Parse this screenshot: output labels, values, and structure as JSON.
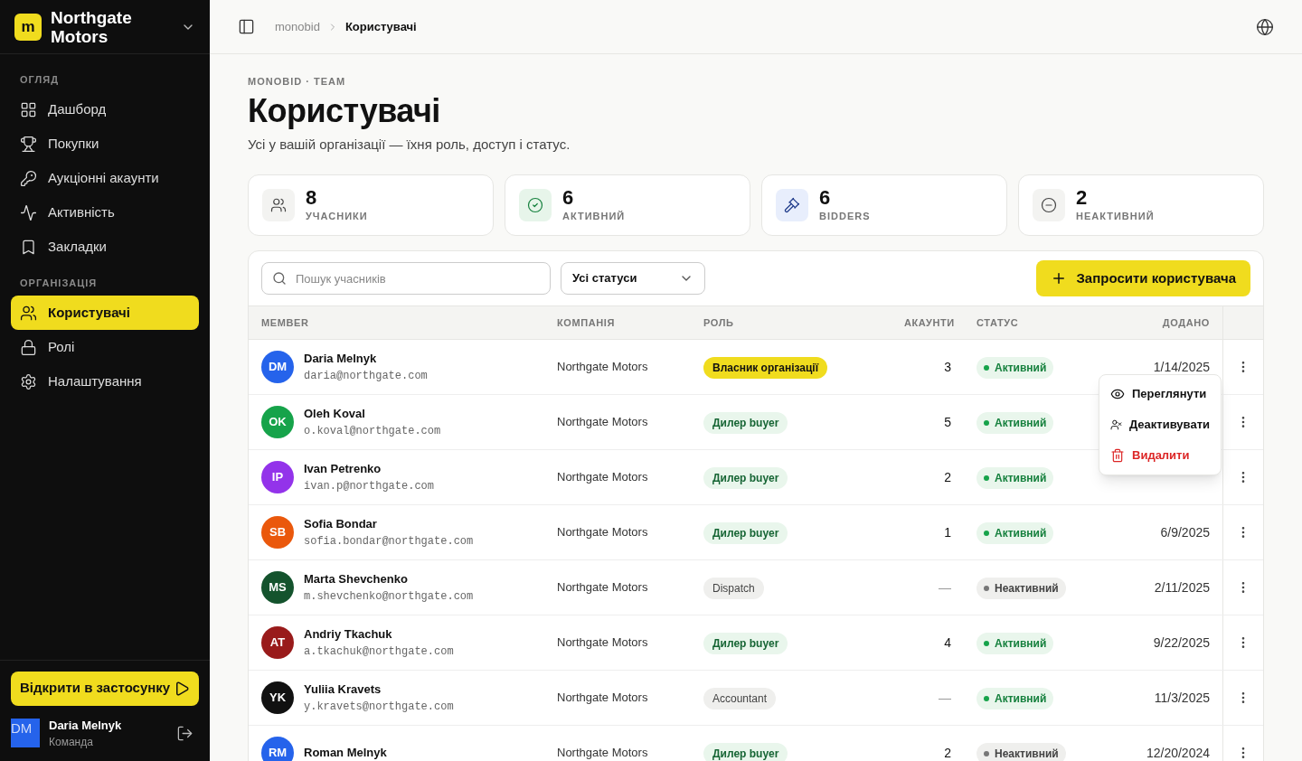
{
  "workspace": {
    "logo": "m",
    "name": "Northgate Motors"
  },
  "sidebar": {
    "sections": [
      {
        "title": "ОГЛЯД",
        "items": [
          {
            "label": "Дашборд",
            "selected": false
          },
          {
            "label": "Покупки",
            "selected": false
          },
          {
            "label": "Аукціонні акаунти",
            "selected": false
          },
          {
            "label": "Активність",
            "selected": false
          },
          {
            "label": "Закладки",
            "selected": false
          }
        ]
      },
      {
        "title": "ОРГАНІЗАЦІЯ",
        "items": [
          {
            "label": "Користувачі",
            "selected": true
          },
          {
            "label": "Ролі",
            "selected": false
          },
          {
            "label": "Налаштування",
            "selected": false
          }
        ]
      }
    ],
    "open_app_button": "Відкрити в застосунку",
    "user": {
      "initials": "DM",
      "name": "Daria Melnyk",
      "team": "Команда"
    }
  },
  "breadcrumb": [
    "monobid",
    "Користувачі"
  ],
  "page": {
    "eyebrow": "MONOBID · TEAM",
    "title": "Користувачі",
    "subtitle": "Усі у вашій організації — їхня роль, доступ і статус."
  },
  "stats": [
    {
      "value": "8",
      "label": "УЧАСНИКИ"
    },
    {
      "value": "6",
      "label": "АКТИВНИЙ"
    },
    {
      "value": "6",
      "label": "BIDDERS"
    },
    {
      "value": "2",
      "label": "НЕАКТИВНИЙ"
    }
  ],
  "toolbar": {
    "search_placeholder": "Пошук учасників",
    "status_filter": "Усі статуси",
    "invite_button": "Запросити користувача"
  },
  "table": {
    "columns": [
      "MEMBER",
      "КОМПАНІЯ",
      "РОЛЬ",
      "АКАУНТИ",
      "СТАТУС",
      "ДОДАНО"
    ],
    "rows": [
      {
        "initials": "DM",
        "color": "#2563eb",
        "name": "Daria Melnyk",
        "email": "daria@northgate.com",
        "company": "Northgate Motors",
        "role": {
          "label": "Власник організації",
          "kind": "owner"
        },
        "accounts": "3",
        "status": "Активний",
        "active": true,
        "added": "1/14/2025"
      },
      {
        "initials": "OK",
        "color": "#16a34a",
        "name": "Oleh Koval",
        "email": "o.koval@northgate.com",
        "company": "Northgate Motors",
        "role": {
          "label": "Дилер buyer",
          "kind": "buyer"
        },
        "accounts": "5",
        "status": "Активний",
        "active": true
      },
      {
        "initials": "IP",
        "color": "#9333ea",
        "name": "Ivan Petrenko",
        "email": "ivan.p@northgate.com",
        "company": "Northgate Motors",
        "role": {
          "label": "Дилер buyer",
          "kind": "buyer"
        },
        "accounts": "2",
        "status": "Активний",
        "active": true
      },
      {
        "initials": "SB",
        "color": "#ea580c",
        "name": "Sofia Bondar",
        "email": "sofia.bondar@northgate.com",
        "company": "Northgate Motors",
        "role": {
          "label": "Дилер buyer",
          "kind": "buyer"
        },
        "accounts": "1",
        "status": "Активний",
        "active": true,
        "added": "6/9/2025"
      },
      {
        "initials": "MS",
        "color": "#14532d",
        "name": "Marta Shevchenko",
        "email": "m.shevchenko@northgate.com",
        "company": "Northgate Motors",
        "role": {
          "label": "Dispatch",
          "kind": "other"
        },
        "accounts": "—",
        "status": "Неактивний",
        "active": false,
        "added": "2/11/2025"
      },
      {
        "initials": "AT",
        "color": "#991b1b",
        "name": "Andriy Tkachuk",
        "email": "a.tkachuk@northgate.com",
        "company": "Northgate Motors",
        "role": {
          "label": "Дилер buyer",
          "kind": "buyer"
        },
        "accounts": "4",
        "status": "Активний",
        "active": true,
        "added": "9/22/2025"
      },
      {
        "initials": "YK",
        "color": "#111111",
        "name": "Yuliia Kravets",
        "email": "y.kravets@northgate.com",
        "company": "Northgate Motors",
        "role": {
          "label": "Accountant",
          "kind": "other"
        },
        "accounts": "—",
        "status": "Активний",
        "active": true,
        "added": "11/3/2025"
      },
      {
        "initials": "RM",
        "color": "#2563eb",
        "name": "Roman Melnyk",
        "company": "Northgate Motors",
        "role": {
          "label": "Дилер buyer",
          "kind": "buyer"
        },
        "accounts": "2",
        "status": "Неактивний",
        "active": false,
        "added": "12/20/2024"
      }
    ]
  },
  "row_menu": [
    {
      "label": "Переглянути",
      "kind": "view"
    },
    {
      "label": "Деактивувати",
      "kind": "deactivate"
    },
    {
      "label": "Видалити",
      "kind": "delete"
    }
  ]
}
